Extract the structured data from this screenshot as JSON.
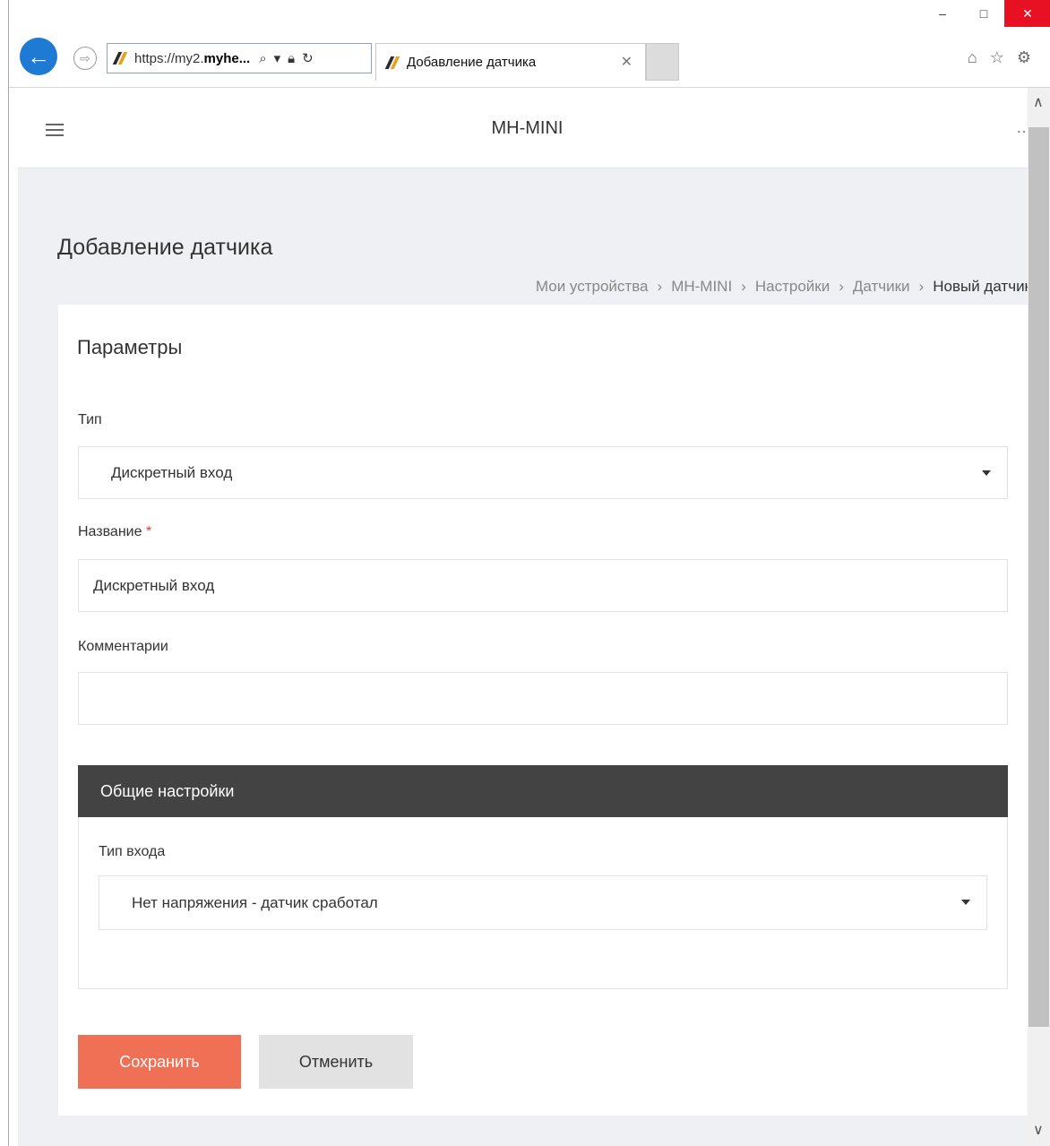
{
  "browser": {
    "url_proto": "https://my2.",
    "url_host": "myhe...",
    "tab_title": "Добавление датчика",
    "window_controls": [
      "minimize-icon",
      "maximize-icon",
      "close-icon"
    ],
    "toolbar_icons": [
      "home-icon",
      "favorites-star-icon",
      "settings-gear-icon"
    ]
  },
  "app": {
    "title": "MH-MINI"
  },
  "page": {
    "title": "Добавление датчика",
    "breadcrumb": [
      "Мои устройства",
      "MH-MINI",
      "Настройки",
      "Датчики",
      "Новый датчик"
    ]
  },
  "form": {
    "section_title": "Параметры",
    "type_label": "Тип",
    "type_value": "Дискретный вход",
    "name_label": "Название",
    "name_required_mark": "*",
    "name_value": "Дискретный вход",
    "comment_label": "Комментарии",
    "comment_value": ""
  },
  "general": {
    "title": "Общие настройки",
    "input_type_label": "Тип входа",
    "input_type_value": "Нет напряжения - датчик сработал"
  },
  "actions": {
    "save": "Сохранить",
    "cancel": "Отменить"
  },
  "colors": {
    "accent": "#ef7055",
    "section_header": "#434343",
    "back_button": "#1e7ad3"
  }
}
